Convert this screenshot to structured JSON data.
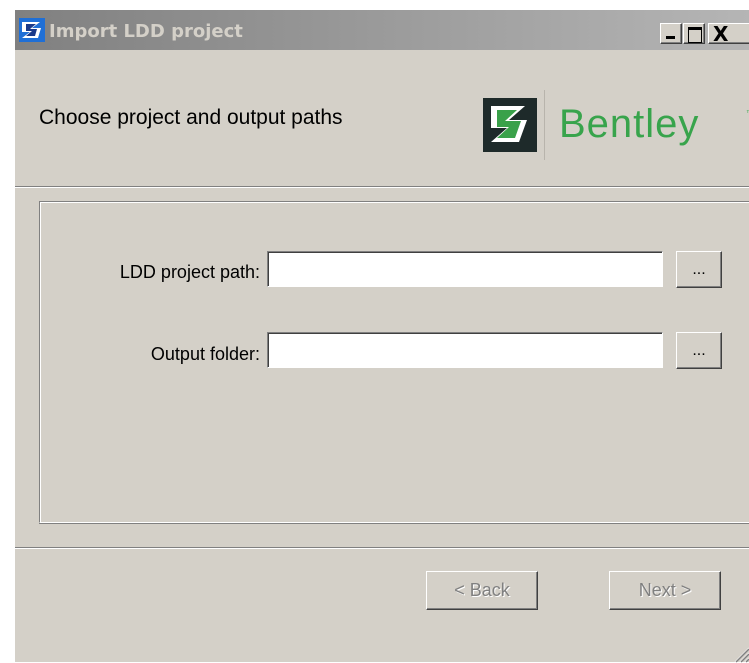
{
  "window": {
    "title": "Import LDD project",
    "close_glyph": "X"
  },
  "header": {
    "heading": "Choose project and output paths",
    "brand_name": "Bentley",
    "brand_tm": "™",
    "brand_color": "#38a44c",
    "logo_icon": "bentley-b-logo"
  },
  "form": {
    "ldd_path": {
      "label": "LDD project path:",
      "value": "",
      "browse_label": "..."
    },
    "output_folder": {
      "label": "Output folder:",
      "value": "",
      "browse_label": "..."
    }
  },
  "footer": {
    "back_label": "< Back",
    "next_label": "Next >"
  }
}
